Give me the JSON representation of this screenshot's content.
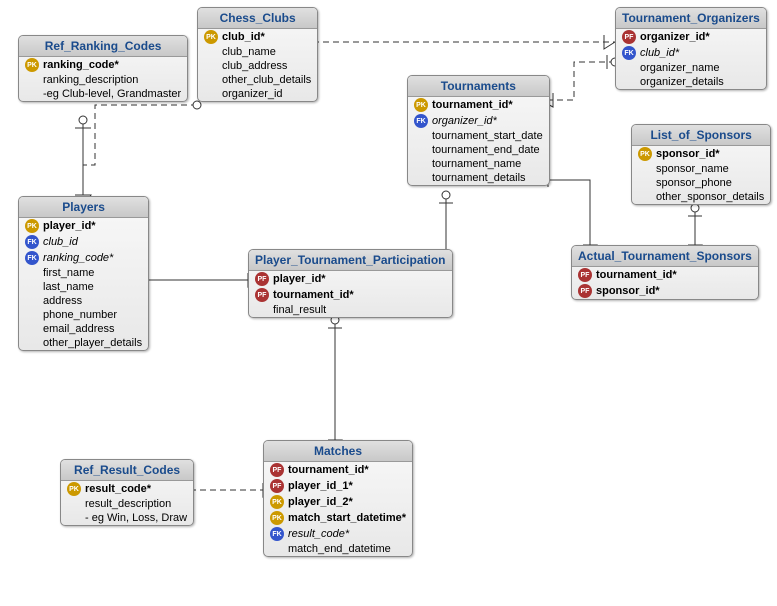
{
  "tables": {
    "ref_ranking": {
      "title": "Ref_Ranking_Codes",
      "cols": [
        {
          "k": "pk",
          "t": "ranking_code*",
          "b": 1
        },
        {
          "t": "ranking_description"
        },
        {
          "t": "-eg Club-level, Grandmaster"
        }
      ]
    },
    "chess_clubs": {
      "title": "Chess_Clubs",
      "cols": [
        {
          "k": "pk",
          "t": "club_id*",
          "b": 1
        },
        {
          "t": "club_name"
        },
        {
          "t": "club_address"
        },
        {
          "t": "other_club_details"
        },
        {
          "t": "organizer_id"
        }
      ]
    },
    "tourn_org": {
      "title": "Tournament_Organizers",
      "cols": [
        {
          "k": "pf",
          "t": "organizer_id*",
          "b": 1
        },
        {
          "k": "fk",
          "t": "club_id*",
          "i": 1
        },
        {
          "t": "organizer_name"
        },
        {
          "t": "organizer_details"
        }
      ]
    },
    "tournaments": {
      "title": "Tournaments",
      "cols": [
        {
          "k": "pk",
          "t": "tournament_id*",
          "b": 1
        },
        {
          "k": "fk",
          "t": "organizer_id*",
          "i": 1
        },
        {
          "t": "tournament_start_date"
        },
        {
          "t": "tournament_end_date"
        },
        {
          "t": "tournament_name"
        },
        {
          "t": "tournament_details"
        }
      ]
    },
    "sponsors": {
      "title": "List_of_Sponsors",
      "cols": [
        {
          "k": "pk",
          "t": "sponsor_id*",
          "b": 1
        },
        {
          "t": "sponsor_name"
        },
        {
          "t": "sponsor_phone"
        },
        {
          "t": "other_sponsor_details"
        }
      ]
    },
    "players": {
      "title": "Players",
      "cols": [
        {
          "k": "pk",
          "t": "player_id*",
          "b": 1
        },
        {
          "k": "fk",
          "t": "club_id",
          "i": 1
        },
        {
          "k": "fk",
          "t": "ranking_code*",
          "i": 1
        },
        {
          "t": "first_name"
        },
        {
          "t": "last_name"
        },
        {
          "t": "address"
        },
        {
          "t": "phone_number"
        },
        {
          "t": "email_address"
        },
        {
          "t": "other_player_details"
        }
      ]
    },
    "ptp": {
      "title": "Player_Tournament_Participation",
      "cols": [
        {
          "k": "pf",
          "t": "player_id*",
          "b": 1
        },
        {
          "k": "pf",
          "t": "tournament_id*",
          "b": 1
        },
        {
          "t": "final_result"
        }
      ]
    },
    "ats": {
      "title": "Actual_Tournament_Sponsors",
      "cols": [
        {
          "k": "pf",
          "t": "tournament_id*",
          "b": 1
        },
        {
          "k": "pf",
          "t": "sponsor_id*",
          "b": 1
        }
      ]
    },
    "ref_result": {
      "title": "Ref_Result_Codes",
      "cols": [
        {
          "k": "pk",
          "t": "result_code*",
          "b": 1
        },
        {
          "t": "result_description"
        },
        {
          "t": "- eg Win, Loss, Draw"
        }
      ]
    },
    "matches": {
      "title": "Matches",
      "cols": [
        {
          "k": "pf",
          "t": "tournament_id*",
          "b": 1
        },
        {
          "k": "pf",
          "t": "player_id_1*",
          "b": 1
        },
        {
          "k": "pk",
          "t": "player_id_2*",
          "b": 1
        },
        {
          "k": "pk",
          "t": "match_start_datetime*",
          "b": 1
        },
        {
          "k": "fk",
          "t": "result_code*",
          "i": 1
        },
        {
          "t": "match_end_datetime"
        }
      ]
    }
  },
  "key_labels": {
    "pk": "PK",
    "fk": "FK",
    "pf": "PF"
  }
}
